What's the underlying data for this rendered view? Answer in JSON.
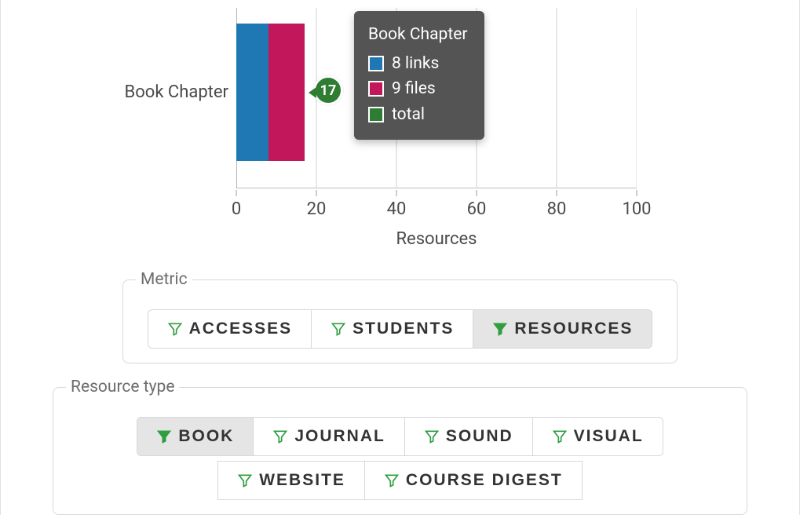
{
  "chart_data": {
    "type": "bar",
    "orientation": "horizontal",
    "stacked": true,
    "categories": [
      "Book Chapter"
    ],
    "series": [
      {
        "name": "links",
        "values": [
          8
        ],
        "color": "#1f77b4"
      },
      {
        "name": "files",
        "values": [
          9
        ],
        "color": "#c2185b"
      }
    ],
    "totals": [
      17
    ],
    "xlabel": "Resources",
    "ylabel": "",
    "xlim": [
      0,
      100
    ],
    "xticks": [
      0,
      20,
      40,
      60,
      80,
      100
    ]
  },
  "tooltip": {
    "title": "Book Chapter",
    "rows": [
      {
        "color": "blue",
        "text": "8 links"
      },
      {
        "color": "pink",
        "text": "9 files"
      },
      {
        "color": "green",
        "text": "total"
      }
    ]
  },
  "badge_value": "17",
  "category_label": "Book Chapter",
  "filters": {
    "metric": {
      "legend": "Metric",
      "options": [
        "ACCESSES",
        "STUDENTS",
        "RESOURCES"
      ],
      "active": "RESOURCES"
    },
    "resource_type": {
      "legend": "Resource type",
      "options_row1": [
        "BOOK",
        "JOURNAL",
        "SOUND",
        "VISUAL"
      ],
      "options_row2": [
        "WEBSITE",
        "COURSE DIGEST"
      ],
      "active": "BOOK"
    }
  }
}
